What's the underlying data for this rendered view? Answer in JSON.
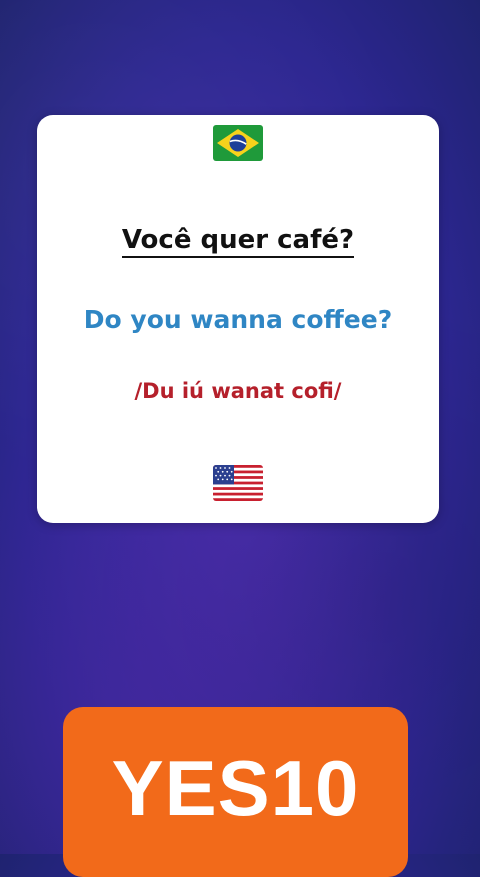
{
  "card": {
    "source_flag_icon": "brazil-flag-icon",
    "question": "Você quer café?",
    "translation": "Do you wanna coffee?",
    "pronunciation": "/Du iú wanat cofi/",
    "target_flag_icon": "usa-flag-icon"
  },
  "promo": {
    "code": "YES10"
  },
  "colors": {
    "background": "#3a2aa0",
    "card": "#ffffff",
    "translation_text": "#2f86c4",
    "pronunciation_text": "#b5202b",
    "promo_button": "#f26a1a"
  }
}
